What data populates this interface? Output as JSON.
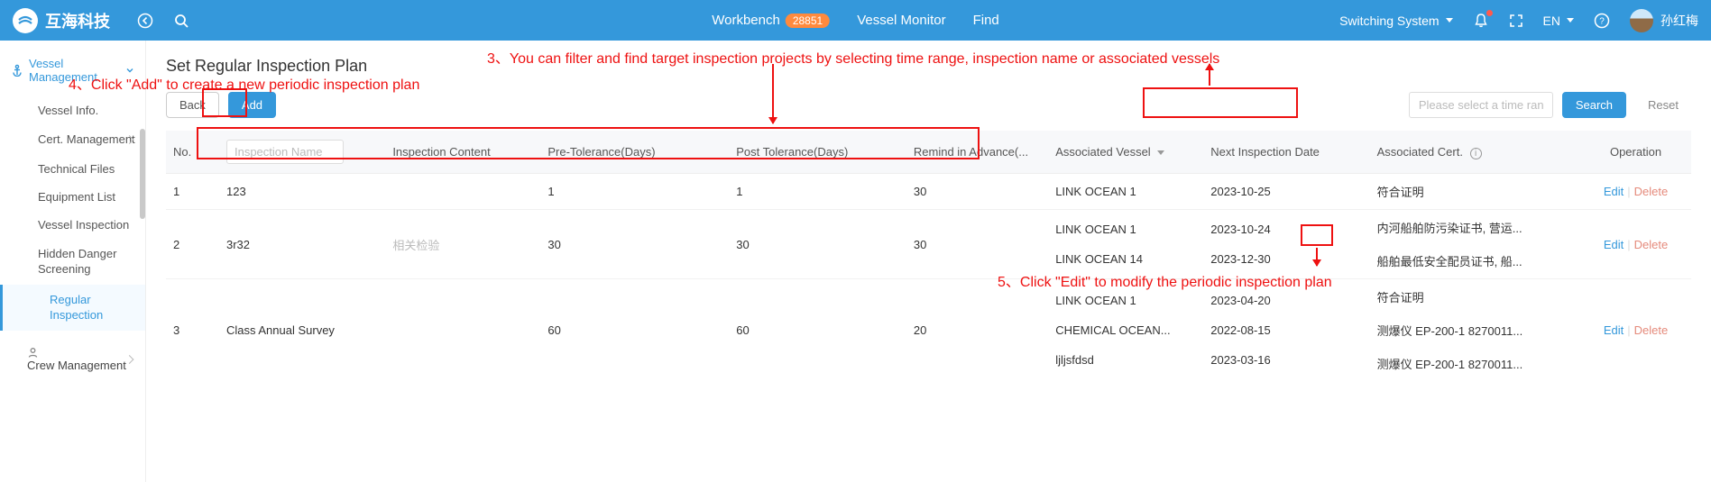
{
  "topbar": {
    "brand": "互海科技",
    "nav": {
      "workbench": "Workbench",
      "workbench_badge": "28851",
      "vessel_monitor": "Vessel Monitor",
      "find": "Find"
    },
    "right": {
      "switching": "Switching System",
      "lang": "EN",
      "username": "孙红梅"
    }
  },
  "sidebar": {
    "section_title": "Vessel Management",
    "items": [
      {
        "label": "Vessel Info."
      },
      {
        "label": "Cert. Management"
      },
      {
        "label": "Technical Files"
      },
      {
        "label": "Equipment List"
      },
      {
        "label": "Vessel Inspection"
      },
      {
        "label": "Hidden Danger Screening"
      },
      {
        "label": "Regular Inspection"
      }
    ],
    "crew_mgmt": "Crew Management"
  },
  "page": {
    "title": "Set Regular Inspection Plan",
    "back": "Back",
    "add": "Add",
    "time_placeholder": "Please select a time range.",
    "search": "Search",
    "reset": "Reset"
  },
  "table": {
    "headers": {
      "no": "No.",
      "name_placeholder": "Inspection Name",
      "content": "Inspection Content",
      "pre": "Pre-Tolerance(Days)",
      "post": "Post Tolerance(Days)",
      "remind": "Remind in Advance(...",
      "vessel": "Associated Vessel",
      "next": "Next Inspection Date",
      "cert": "Associated Cert.",
      "op": "Operation"
    },
    "op_edit": "Edit",
    "op_delete": "Delete",
    "rows": [
      {
        "no": "1",
        "name": "123",
        "content": "",
        "pre": "1",
        "post": "1",
        "remind": "30",
        "vessel": [
          "LINK OCEAN 1"
        ],
        "next": [
          "2023-10-25"
        ],
        "cert": [
          "符合证明"
        ]
      },
      {
        "no": "2",
        "name": "3r32",
        "content": "相关检验",
        "pre": "30",
        "post": "30",
        "remind": "30",
        "vessel": [
          "LINK OCEAN 1",
          "LINK OCEAN 14"
        ],
        "next": [
          "2023-10-24",
          "2023-12-30"
        ],
        "cert": [
          "内河船舶防污染证书, 营运...",
          "船舶最低安全配员证书, 船..."
        ]
      },
      {
        "no": "3",
        "name": "Class Annual Survey",
        "content": "",
        "pre": "60",
        "post": "60",
        "remind": "20",
        "vessel": [
          "LINK OCEAN 1",
          "CHEMICAL OCEAN...",
          "ljljsfdsd"
        ],
        "next": [
          "2023-04-20",
          "2022-08-15",
          "2023-03-16"
        ],
        "cert": [
          "符合证明",
          "测爆仪 EP-200-1 8270011...",
          "测爆仪 EP-200-1 8270011..."
        ]
      }
    ]
  },
  "annotations": {
    "a3": "3、You can filter and find target inspection projects by selecting time range, inspection name or associated vessels",
    "a4": "4、Click \"Add\" to create a new periodic inspection plan",
    "a5": "5、Click \"Edit\" to modify the periodic inspection plan"
  }
}
